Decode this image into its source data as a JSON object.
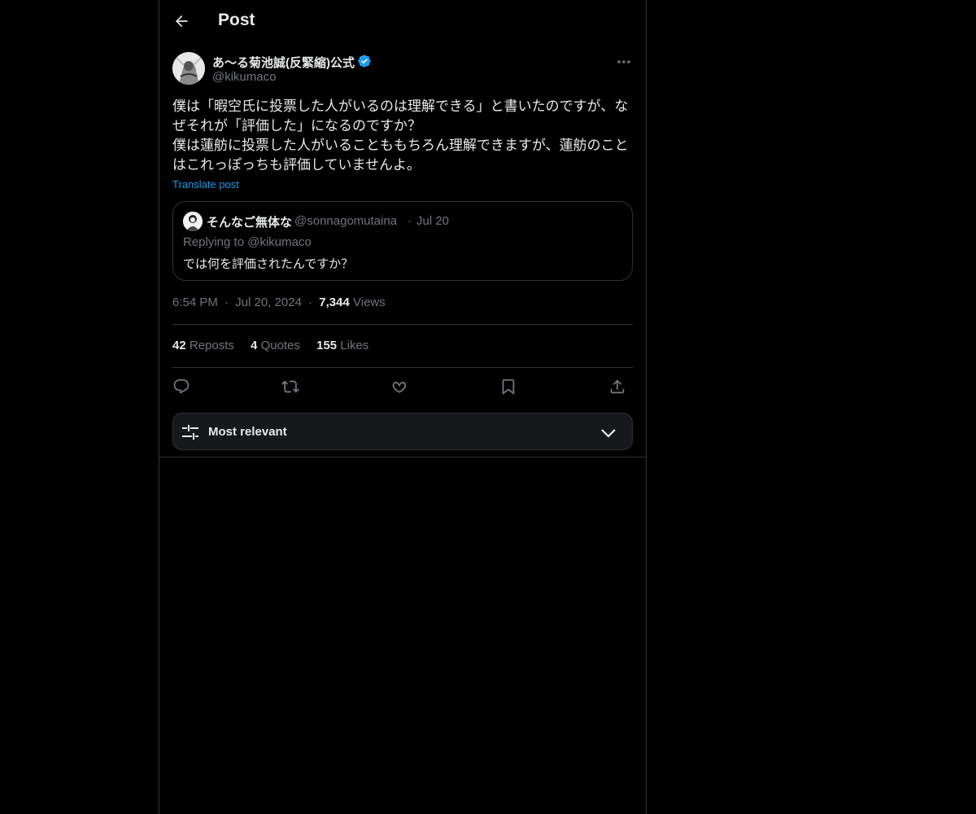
{
  "header": {
    "title": "Post"
  },
  "author": {
    "name": "あ〜る菊池誠(反緊縮)公式",
    "handle": "@kikumaco",
    "verified": true
  },
  "post": {
    "lines": [
      "僕は「暇空氏に投票した人がいるのは理解できる」と書いたのですが、な",
      "ぜそれが「評価した」になるのですか？",
      "僕は蓮舫に投票した人がいることももちろん理解できますが、蓮舫のこと",
      "はこれっぽっちも評価していませんよ。"
    ],
    "translate_label": "Translate post"
  },
  "quote": {
    "name": "そんなご無体な",
    "handle": "@sonnagomutaina",
    "separator": "·",
    "date": "Jul 20",
    "replying_prefix": "Replying to",
    "replying_to": "@kikumaco",
    "text": "では何を評価されたんですか？"
  },
  "meta": {
    "time": "6:54 PM",
    "sep1": "·",
    "date": "Jul 20, 2024",
    "sep2": "·",
    "views_count": "7,344",
    "views_label": "Views"
  },
  "stats": {
    "reposts_count": "42",
    "reposts_label": "Reposts",
    "quotes_count": "4",
    "quotes_label": "Quotes",
    "likes_count": "155",
    "likes_label": "Likes"
  },
  "actions": [
    "reply-icon",
    "repost-icon",
    "like-icon",
    "bookmark-icon",
    "share-icon"
  ],
  "sort": {
    "label": "Most relevant"
  },
  "colors": {
    "accent": "#1d9bf0",
    "background": "#000000",
    "muted": "#71767b",
    "text": "#e7e9ea",
    "border": "#2f3336"
  }
}
